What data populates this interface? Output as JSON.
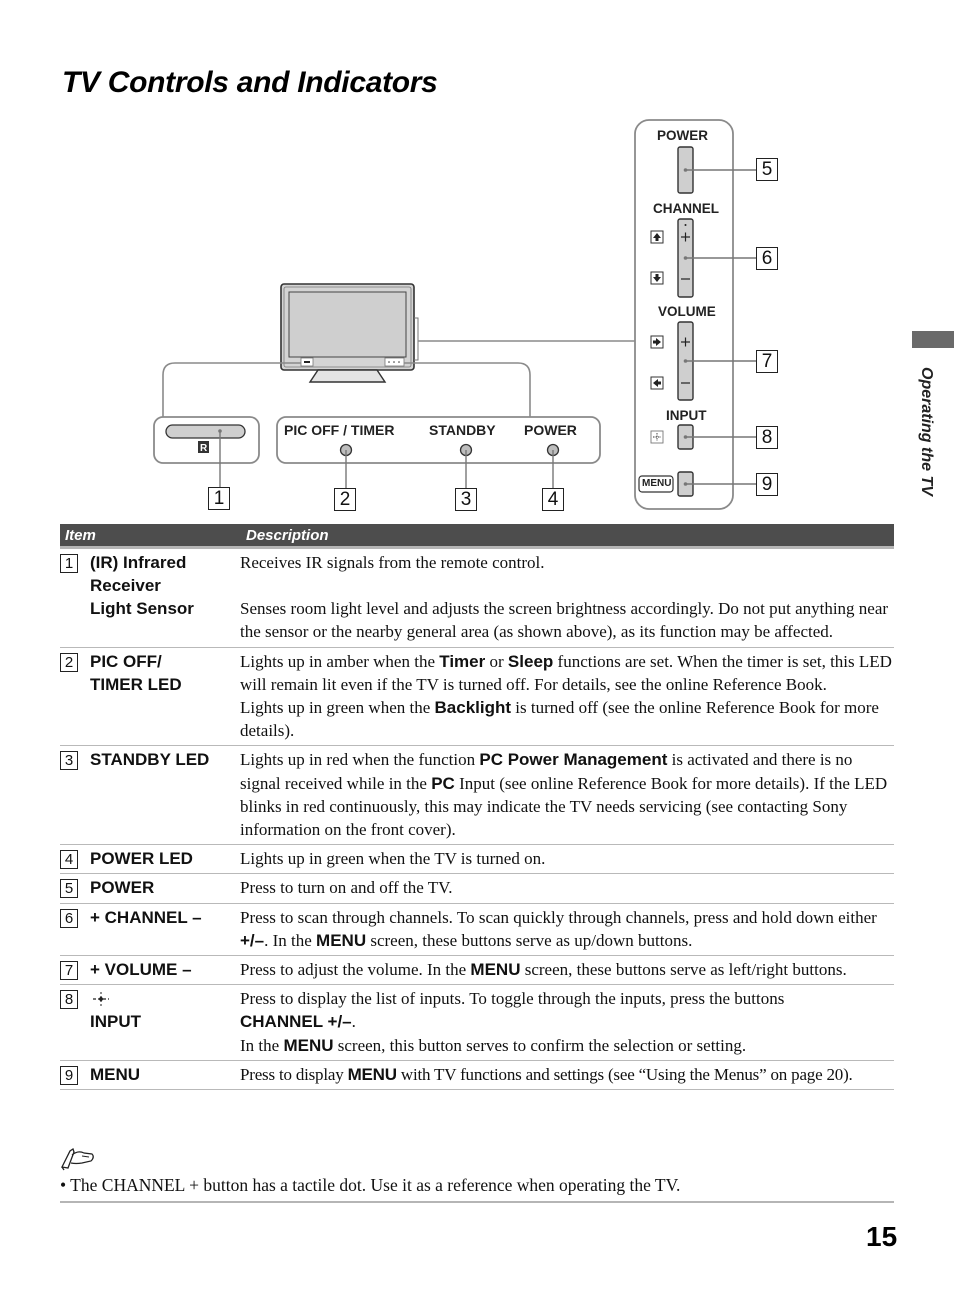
{
  "page": {
    "title": "TV Controls and Indicators",
    "section_tab": "Operating the TV",
    "page_number": "15"
  },
  "diagram": {
    "front_panel": {
      "ir_symbol": "IR-icon",
      "labels": [
        "PIC OFF / TIMER",
        "STANDBY",
        "POWER"
      ]
    },
    "side_panel": {
      "labels": {
        "power": "POWER",
        "channel": "CHANNEL",
        "volume": "VOLUME",
        "input": "INPUT",
        "menu": "MENU"
      },
      "button_glyphs": {
        "plus": "+",
        "minus": "—"
      }
    },
    "callouts": [
      "1",
      "2",
      "3",
      "4",
      "5",
      "6",
      "7",
      "8",
      "9"
    ]
  },
  "table": {
    "headers": {
      "item": "Item",
      "description": "Description"
    },
    "rows": [
      {
        "num": "1",
        "item_lines": [
          "(IR) Infrared",
          "Receiver"
        ],
        "item_line2": "Light Sensor",
        "desc_a": "Receives IR signals from the remote control.",
        "desc_b": "Senses room light level and adjusts the screen brightness accordingly. Do not put anything near the sensor or the nearby general area (as shown above), as its function may be affected."
      },
      {
        "num": "2",
        "item_lines": [
          "PIC OFF/",
          "TIMER LED"
        ],
        "desc_parts": [
          "Lights up in amber when the ",
          "Timer",
          " or ",
          "Sleep",
          " functions are set. When the timer is set, this LED will remain lit even if the TV is turned off. For details, see the online Reference Book."
        ],
        "desc_parts_2": [
          "Lights up in green when the ",
          "Backlight",
          " is turned off (see the online Reference Book for more details)."
        ]
      },
      {
        "num": "3",
        "item": "STANDBY LED",
        "desc_parts": [
          "Lights up in red when the function ",
          "PC Power Management",
          " is activated and there is no signal received while in the ",
          "PC",
          " Input (see online Reference Book for more details). If the LED blinks in red continuously, this may indicate the TV needs servicing (see contacting Sony information on the front cover)."
        ]
      },
      {
        "num": "4",
        "item": "POWER LED",
        "desc": "Lights up in green when the TV is turned on."
      },
      {
        "num": "5",
        "item": "POWER",
        "desc": "Press to turn on and off the TV."
      },
      {
        "num": "6",
        "item": "+ CHANNEL –",
        "desc_parts": [
          "Press to scan through channels. To scan quickly through channels, press and hold down either ",
          "+/–",
          ". In the ",
          "MENU",
          " screen, these buttons serve as up/down buttons."
        ]
      },
      {
        "num": "7",
        "item": "+ VOLUME –",
        "desc_parts": [
          "Press to adjust the volume. In the ",
          "MENU",
          " screen, these buttons serve as left/right buttons."
        ]
      },
      {
        "num": "8",
        "item_icon": "input-icon",
        "item": "INPUT",
        "desc_parts": [
          "Press to display the list of inputs. To toggle through the inputs, press the buttons "
        ],
        "desc_bold_line": "CHANNEL +/–",
        "desc_bold_tail": ".",
        "desc_parts_2": [
          "In the ",
          "MENU",
          " screen, this button serves to confirm the selection or setting."
        ]
      },
      {
        "num": "9",
        "item": "MENU",
        "desc_parts": [
          "Press to display ",
          "MENU",
          " with TV functions and settings (see “Using the Menus” on page 20)."
        ]
      }
    ]
  },
  "note": {
    "icon": "pencil-note-icon",
    "text": "• The CHANNEL + button has a tactile dot. Use it as a reference when operating the TV."
  },
  "colors": {
    "header_bg": "#4d4d4d",
    "panel_stroke": "#8a8a8a",
    "button_fill": "#cfcfcf",
    "side_tab": "#6a6a6a"
  }
}
